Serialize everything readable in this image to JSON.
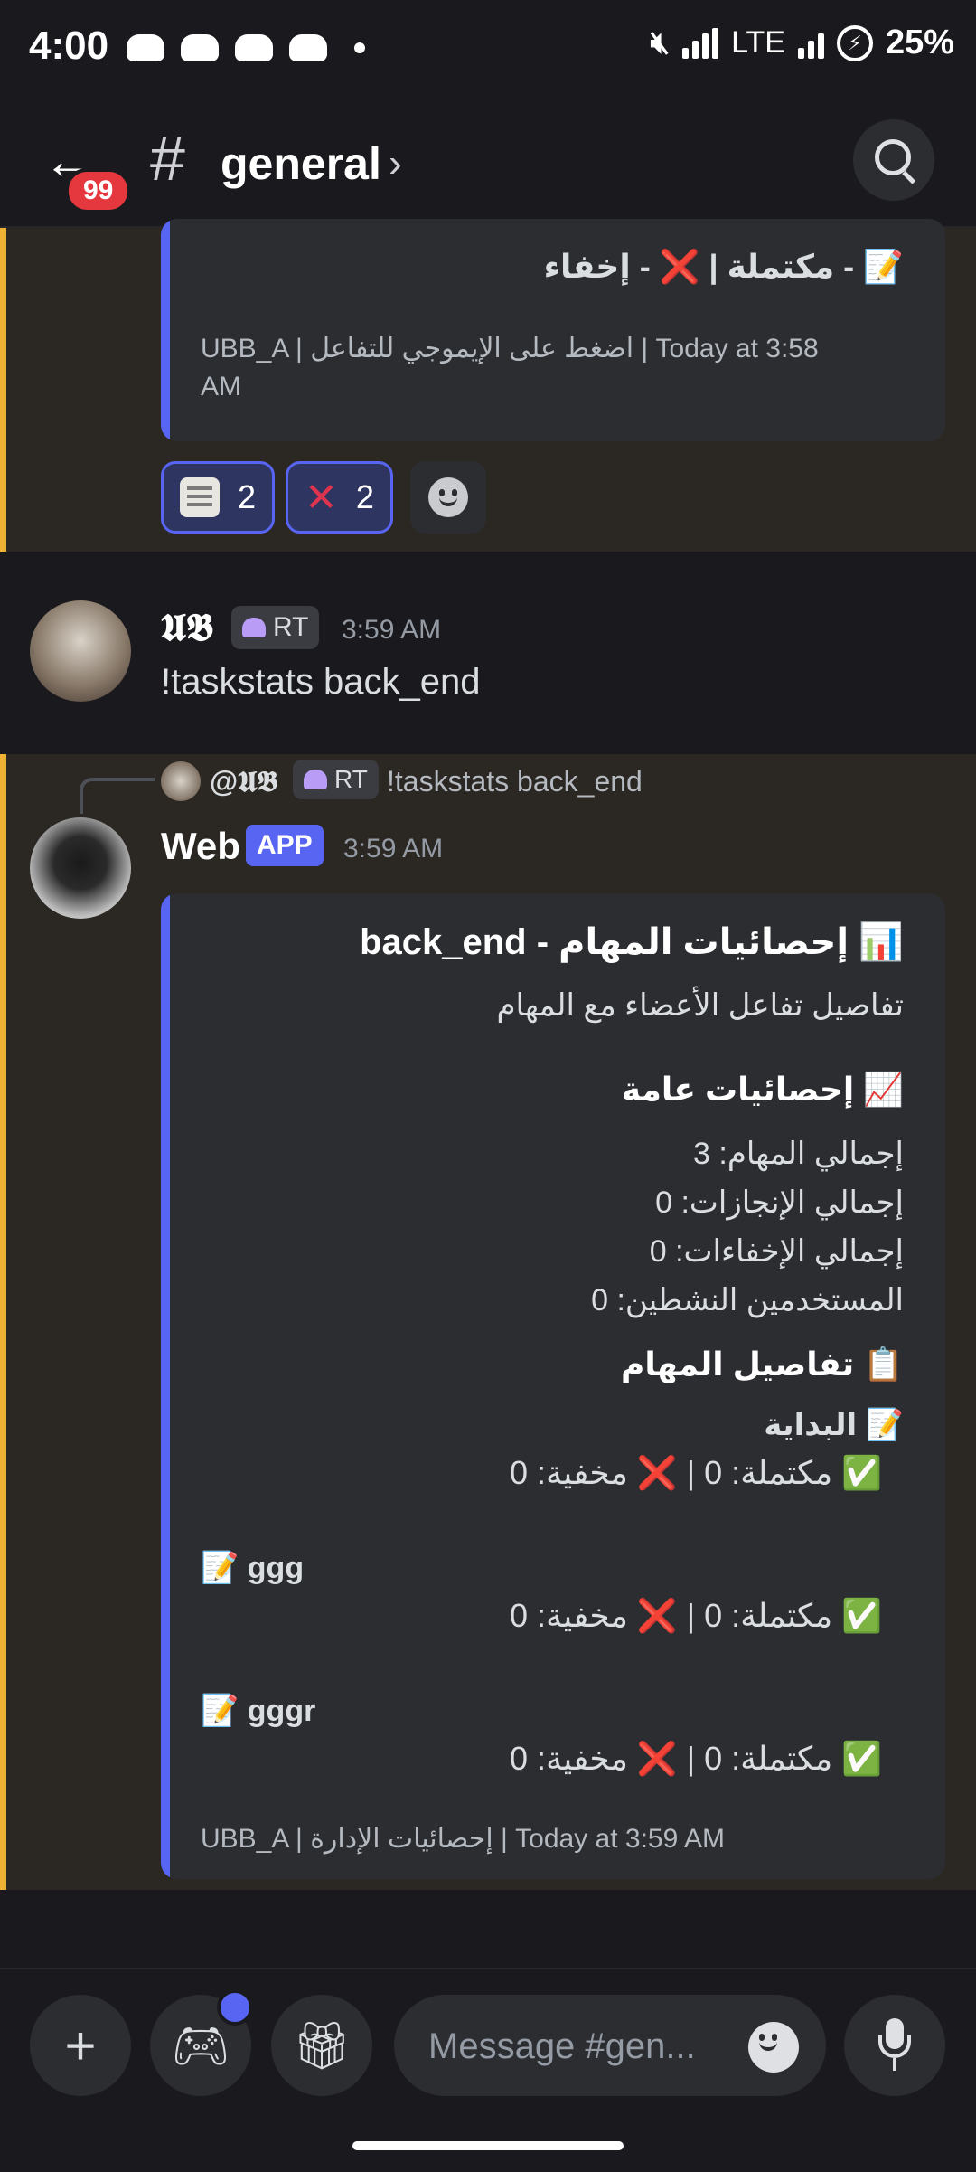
{
  "status": {
    "time": "4:00",
    "network": "LTE",
    "battery": "25%"
  },
  "header": {
    "badge": "99",
    "hash": "#",
    "channel": "general",
    "chevron": "›"
  },
  "prev_embed": {
    "line": "📝 - مكتملة | ❌ - إخفاء",
    "footer_line1": "UBB_A | اضغط على الإيموجي للتفاعل | Today at 3:58",
    "footer_line2": "AM"
  },
  "reactions": [
    {
      "icon": "memo-emoji",
      "count": "2"
    },
    {
      "icon": "cross-mark-emoji",
      "count": "2"
    }
  ],
  "msg1": {
    "username": "𝖀𝕭",
    "role": "RT",
    "time": "3:59 AM",
    "text": "!taskstats back_end"
  },
  "reply": {
    "mention": "@𝖀𝕭",
    "role": "RT",
    "text": "!taskstats back_end"
  },
  "msg2": {
    "username": "Web",
    "tag": "APP",
    "time": "3:59 AM",
    "embed": {
      "title": "📊 إحصائيات المهام - back_end",
      "description": "تفاصيل تفاعل الأعضاء مع المهام",
      "general_heading": "📈 إحصائيات عامة",
      "general_lines": [
        "إجمالي المهام: 3",
        "إجمالي الإنجازات: 0",
        "إجمالي الإخفاءات: 0",
        "المستخدمين النشطين: 0"
      ],
      "details_heading": "📋 تفاصيل المهام",
      "tasks": [
        {
          "name": "📝 البداية",
          "stats": "✅ مكتملة: 0 | ❌ مخفية: 0"
        },
        {
          "name": "📝 ggg",
          "stats": "✅ مكتملة: 0 | ❌ مخفية: 0"
        },
        {
          "name": "📝 gggr",
          "stats": "✅ مكتملة: 0 | ❌ مخفية: 0"
        }
      ],
      "footer": "UBB_A | إحصائيات الإدارة | Today at 3:59 AM"
    }
  },
  "composer": {
    "placeholder": "Message #gen..."
  },
  "colors": {
    "accent": "#5865f2",
    "highlight_bar": "#f0b232",
    "badge": "#e5383e"
  }
}
